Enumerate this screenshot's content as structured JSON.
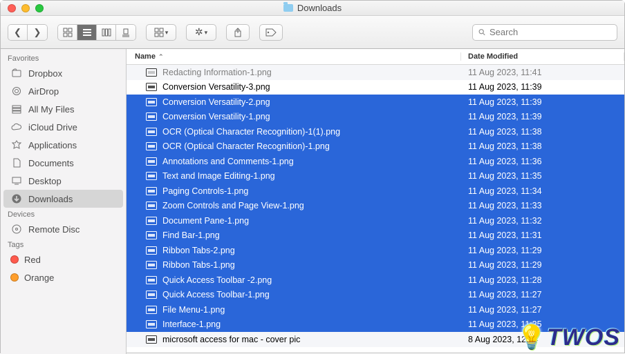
{
  "window": {
    "title": "Downloads"
  },
  "search": {
    "placeholder": "Search"
  },
  "sidebar": {
    "sections": [
      {
        "label": "Favorites",
        "items": [
          {
            "icon": "dropbox",
            "label": "Dropbox",
            "selected": false
          },
          {
            "icon": "airdrop",
            "label": "AirDrop",
            "selected": false
          },
          {
            "icon": "allfiles",
            "label": "All My Files",
            "selected": false
          },
          {
            "icon": "icloud",
            "label": "iCloud Drive",
            "selected": false
          },
          {
            "icon": "apps",
            "label": "Applications",
            "selected": false
          },
          {
            "icon": "docs",
            "label": "Documents",
            "selected": false
          },
          {
            "icon": "desktop",
            "label": "Desktop",
            "selected": false
          },
          {
            "icon": "downloads",
            "label": "Downloads",
            "selected": true
          }
        ]
      },
      {
        "label": "Devices",
        "items": [
          {
            "icon": "disc",
            "label": "Remote Disc",
            "selected": false
          }
        ]
      },
      {
        "label": "Tags",
        "items": [
          {
            "icon": "tag",
            "color": "#ff5a4d",
            "label": "Red"
          },
          {
            "icon": "tag",
            "color": "#ff9e2c",
            "label": "Orange"
          }
        ]
      }
    ]
  },
  "columns": {
    "name": "Name",
    "date": "Date Modified"
  },
  "files": [
    {
      "name": "Redacting Information-1.png",
      "date": "11 Aug 2023, 11:41",
      "selected": false,
      "dim": true
    },
    {
      "name": "Conversion Versatility-3.png",
      "date": "11 Aug 2023, 11:39",
      "selected": false
    },
    {
      "name": "Conversion Versatility-2.png",
      "date": "11 Aug 2023, 11:39",
      "selected": true
    },
    {
      "name": "Conversion Versatility-1.png",
      "date": "11 Aug 2023, 11:39",
      "selected": true
    },
    {
      "name": "OCR (Optical Character Recognition)-1(1).png",
      "date": "11 Aug 2023, 11:38",
      "selected": true
    },
    {
      "name": "OCR (Optical Character Recognition)-1.png",
      "date": "11 Aug 2023, 11:38",
      "selected": true
    },
    {
      "name": "Annotations and Comments-1.png",
      "date": "11 Aug 2023, 11:36",
      "selected": true
    },
    {
      "name": "Text and Image Editing-1.png",
      "date": "11 Aug 2023, 11:35",
      "selected": true
    },
    {
      "name": "Paging Controls-1.png",
      "date": "11 Aug 2023, 11:34",
      "selected": true
    },
    {
      "name": "Zoom Controls and Page View-1.png",
      "date": "11 Aug 2023, 11:33",
      "selected": true
    },
    {
      "name": "Document Pane-1.png",
      "date": "11 Aug 2023, 11:32",
      "selected": true
    },
    {
      "name": "Find Bar-1.png",
      "date": "11 Aug 2023, 11:31",
      "selected": true
    },
    {
      "name": "Ribbon Tabs-2.png",
      "date": "11 Aug 2023, 11:29",
      "selected": true
    },
    {
      "name": "Ribbon Tabs-1.png",
      "date": "11 Aug 2023, 11:29",
      "selected": true
    },
    {
      "name": "Quick Access Toolbar -2.png",
      "date": "11 Aug 2023, 11:28",
      "selected": true
    },
    {
      "name": "Quick Access Toolbar-1.png",
      "date": "11 Aug 2023, 11:27",
      "selected": true
    },
    {
      "name": "File Menu-1.png",
      "date": "11 Aug 2023, 11:27",
      "selected": true
    },
    {
      "name": "Interface-1.png",
      "date": "11 Aug 2023, 11:25",
      "selected": true
    },
    {
      "name": "microsoft access for mac - cover pic",
      "date": "8 Aug 2023, 12:04",
      "selected": false
    }
  ],
  "watermark": "TWOS"
}
